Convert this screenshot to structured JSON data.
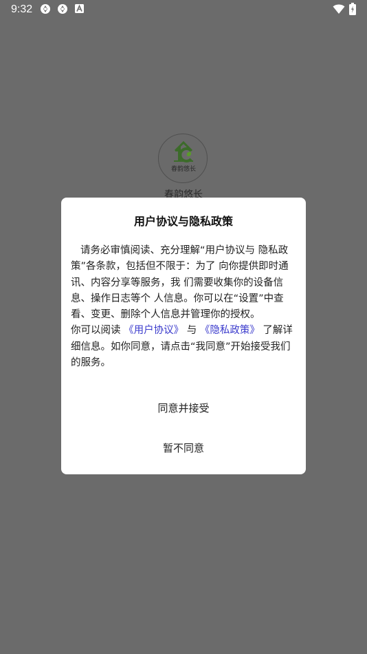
{
  "status_bar": {
    "time": "9:32",
    "icons": [
      "sync-icon",
      "sync-icon",
      "a-notification-icon"
    ],
    "right_icons": [
      "wifi-icon",
      "battery-icon"
    ]
  },
  "splash": {
    "logo_text": "春韵悠长",
    "app_name": "春韵悠长"
  },
  "dialog": {
    "title": "用户协议与隐私政策",
    "paragraph1": "请务必审慎阅读、充分理解“用户协议与 隐私政策”各条款，包括但不限于：为了 向你提供即时通讯、内容分享等服务，我 们需要收集你的设备信息、操作日志等个 人信息。你可以在“设置”中查看、变更、删除个人信息并管理你的授权。",
    "p2_prefix": "你可以阅读 ",
    "link_user_agreement": "《用户协议》",
    "p2_and": " 与 ",
    "link_privacy_policy": "《隐私政策》",
    "p2_suffix": " 了解详细信息。如你同意，请点击“我同意”开始接受我们的服务。",
    "agree_button": "同意并接受",
    "disagree_button": "暂不同意"
  },
  "colors": {
    "overlay_background": "#6b6b6b",
    "dialog_background": "#ffffff",
    "link": "#3a3acc",
    "logo_green": "#3c6b2a"
  }
}
